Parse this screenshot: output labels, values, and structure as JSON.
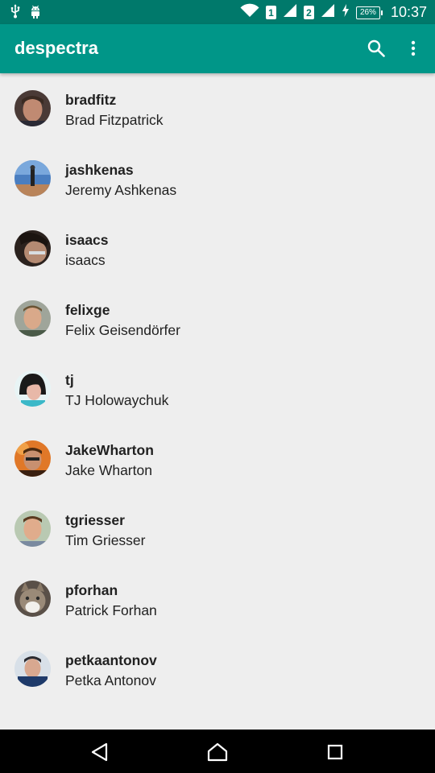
{
  "status_bar": {
    "sim1": "1",
    "sim2": "2",
    "battery": "26%",
    "time": "10:37"
  },
  "app_bar": {
    "title": "despectra",
    "color": "#009688",
    "status_color": "#00796b"
  },
  "users": [
    {
      "username": "bradfitz",
      "name": "Brad Fitzpatrick"
    },
    {
      "username": "jashkenas",
      "name": "Jeremy Ashkenas"
    },
    {
      "username": "isaacs",
      "name": "isaacs"
    },
    {
      "username": "felixge",
      "name": "Felix Geisendörfer"
    },
    {
      "username": "tj",
      "name": "TJ Holowaychuk"
    },
    {
      "username": "JakeWharton",
      "name": "Jake Wharton"
    },
    {
      "username": "tgriesser",
      "name": "Tim Griesser"
    },
    {
      "username": "pforhan",
      "name": "Patrick Forhan"
    },
    {
      "username": "petkaantonov",
      "name": "Petka Antonov"
    }
  ]
}
